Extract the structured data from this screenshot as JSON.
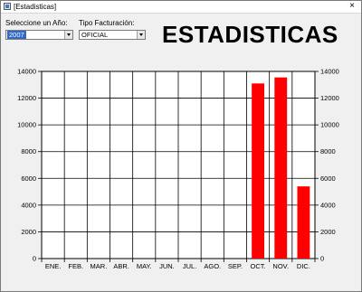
{
  "window": {
    "title": "[Estadisticas]",
    "close_glyph": "×"
  },
  "filters": {
    "year_label": "Seleccione un Año:",
    "year_value": "2007",
    "type_label": "Tipo Facturación:",
    "type_value": "OFICIAL"
  },
  "heading": "ESTADISTICAS",
  "colors": {
    "bar": "#ff0000",
    "grid": "#000000",
    "plot_bg": "#ffffff"
  },
  "chart_data": {
    "type": "bar",
    "title": "",
    "xlabel": "",
    "ylabel": "",
    "categories": [
      "ENE.",
      "FEB.",
      "MAR.",
      "ABR.",
      "MAY.",
      "JUN.",
      "JUL.",
      "AGO.",
      "SEP.",
      "OCT.",
      "NOV.",
      "DIC."
    ],
    "values": [
      0,
      0,
      0,
      0,
      0,
      0,
      0,
      0,
      0,
      13100,
      13550,
      5400
    ],
    "ylim": [
      0,
      14000
    ],
    "yticks": [
      0,
      2000,
      4000,
      6000,
      8000,
      10000,
      12000,
      14000
    ],
    "grid": true,
    "right_axis": true
  }
}
